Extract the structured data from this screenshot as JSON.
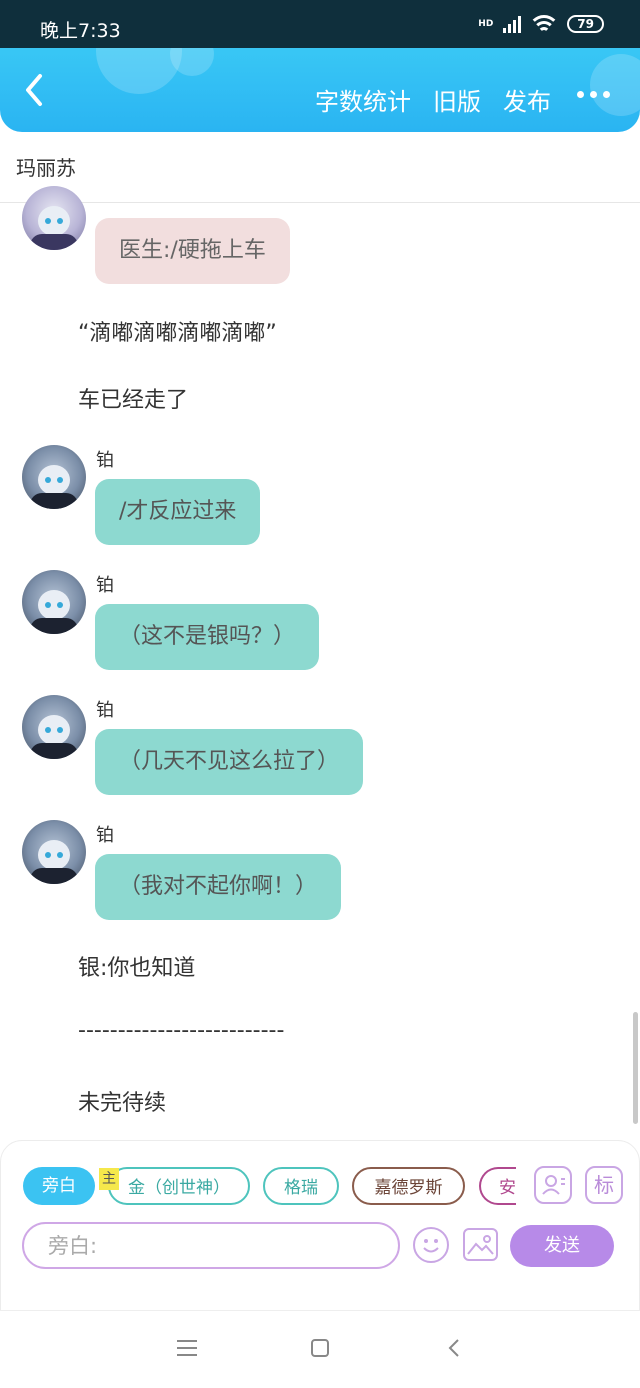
{
  "status": {
    "time": "晚上7:33",
    "network": "HD",
    "battery": "79"
  },
  "header": {
    "actions": [
      "字数统计",
      "旧版",
      "发布"
    ],
    "more_icon": "more-dots-icon"
  },
  "story": {
    "title": "玛丽苏"
  },
  "messages": [
    {
      "type": "dialog",
      "speaker": "",
      "text": "医生:/硬拖上车",
      "style": "pink"
    },
    {
      "type": "narration",
      "text": "“滴嘟滴嘟滴嘟滴嘟”"
    },
    {
      "type": "narration",
      "text": "车已经走了"
    },
    {
      "type": "dialog",
      "speaker": "铂",
      "text": "/才反应过来",
      "style": "teal"
    },
    {
      "type": "dialog",
      "speaker": "铂",
      "text": "（这不是银吗？）",
      "style": "teal"
    },
    {
      "type": "dialog",
      "speaker": "铂",
      "text": "（几天不见这么拉了）",
      "style": "teal"
    },
    {
      "type": "dialog",
      "speaker": "铂",
      "text": "（我对不起你啊！）",
      "style": "teal"
    },
    {
      "type": "narration",
      "text": "银:你也知道"
    },
    {
      "type": "narration",
      "text": "--------------------------"
    },
    {
      "type": "narration",
      "text": "未完待续"
    }
  ],
  "composer": {
    "characters": [
      {
        "label": "旁白",
        "state": "active"
      },
      {
        "label": "金（创世神）",
        "state": "teal"
      },
      {
        "label": "格瑞",
        "state": "teal"
      },
      {
        "label": "嘉德罗斯",
        "state": "brown"
      },
      {
        "label": "安",
        "state": "purple"
      }
    ],
    "owner_tag": "主",
    "role_icon": "character-manage-icon",
    "tag_button": "标",
    "input_placeholder": "旁白:",
    "send_label": "发送",
    "emoji_icon": "emoji-icon",
    "image_icon": "image-icon"
  },
  "colors": {
    "header": "#2ab4f2",
    "teal_bubble": "#8dd9d0",
    "pink_bubble": "#f2dede",
    "send": "#b78ae8"
  }
}
